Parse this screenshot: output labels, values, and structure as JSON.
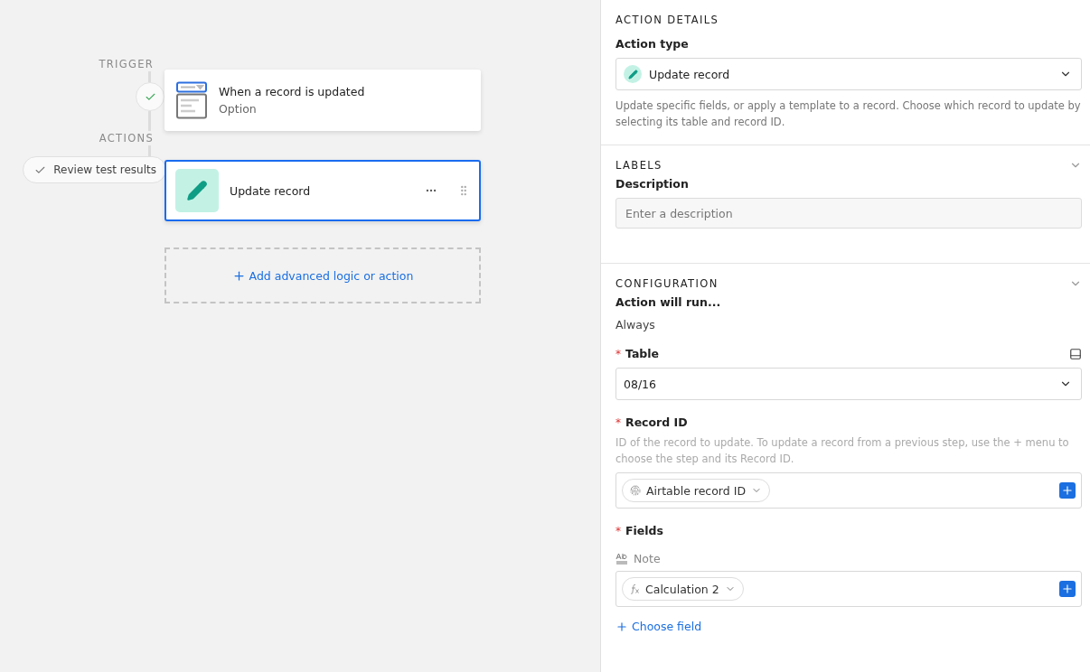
{
  "canvas": {
    "trigger_label": "TRIGGER",
    "trigger": {
      "title": "When a record is updated",
      "subtitle": "Option"
    },
    "actions_label": "ACTIONS",
    "review_button": "Review test results",
    "actions": [
      {
        "title": "Update record",
        "selected": true
      }
    ],
    "add_button": "Add advanced logic or action"
  },
  "panel": {
    "action_details": {
      "heading": "ACTION DETAILS",
      "type_label": "Action type",
      "type_value": "Update record",
      "description": "Update specific fields, or apply a template to a record. Choose which record to update by selecting its table and record ID."
    },
    "labels": {
      "heading": "LABELS",
      "description_label": "Description",
      "description_placeholder": "Enter a description"
    },
    "configuration": {
      "heading": "CONFIGURATION",
      "run_label": "Action will run...",
      "run_value": "Always",
      "table": {
        "required_mark": "*",
        "label": "Table",
        "value": "08/16"
      },
      "record_id": {
        "required_mark": "*",
        "label": "Record ID",
        "help": "ID of the record to update. To update a record from a previous step, use the + menu to choose the step and its Record ID.",
        "token": "Airtable record ID"
      },
      "fields": {
        "required_mark": "*",
        "label": "Fields",
        "items": [
          {
            "name": "Note",
            "token": "Calculation 2"
          }
        ],
        "add": "Choose field"
      }
    }
  }
}
